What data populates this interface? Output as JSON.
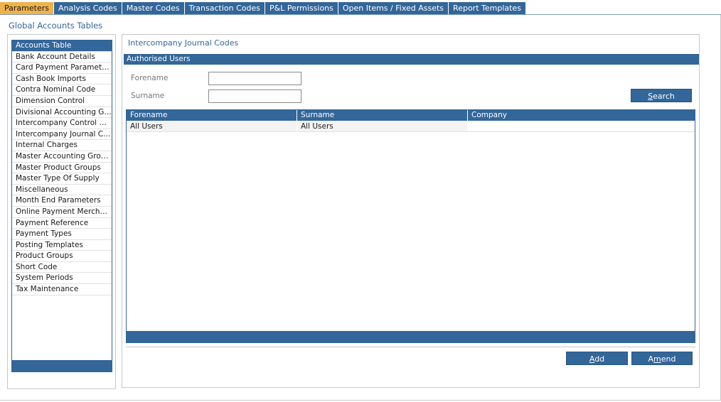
{
  "tabs": [
    {
      "label": "Parameters",
      "active": true
    },
    {
      "label": "Analysis Codes",
      "active": false
    },
    {
      "label": "Master Codes",
      "active": false
    },
    {
      "label": "Transaction Codes",
      "active": false
    },
    {
      "label": "P&L Permissions",
      "active": false
    },
    {
      "label": "Open Items / Fixed Assets",
      "active": false
    },
    {
      "label": "Report Templates",
      "active": false
    }
  ],
  "global_title": "Global Accounts Tables",
  "sidebar": {
    "items": [
      "Accounts Table",
      "Bank Account Details",
      "Card Payment Parameters",
      "Cash Book Imports",
      "Contra Nominal Code",
      "Dimension Control",
      "Divisional Accounting Gro...",
      "Intercompany Control Co...",
      "Intercompany Journal Co...",
      "Internal Charges",
      "Master Accounting Groups",
      "Master Product Groups",
      "Master Type Of Supply",
      "Miscellaneous",
      "Month End Parameters",
      "Online Payment Merchants",
      "Payment Reference",
      "Payment Types",
      "Posting Templates",
      "Product Groups",
      "Short Code",
      "System Periods",
      "Tax Maintenance"
    ],
    "selected_index": 0
  },
  "panel": {
    "title": "Intercompany Journal Codes",
    "section_title": "Authorised Users",
    "forename_label": "Forename",
    "surname_label": "Surname",
    "forename_value": "",
    "surname_value": "",
    "search_underline": "S",
    "search_rest": "earch",
    "grid": {
      "columns": [
        "Forename",
        "Surname",
        "Company"
      ],
      "rows": [
        [
          "All Users",
          "All Users",
          ""
        ]
      ]
    },
    "add_underline": "A",
    "add_rest": "dd",
    "amend_prefix": "A",
    "amend_underline": "m",
    "amend_rest": "end"
  },
  "colors": {
    "accent": "#336699",
    "active_tab": "#f0b24a"
  }
}
